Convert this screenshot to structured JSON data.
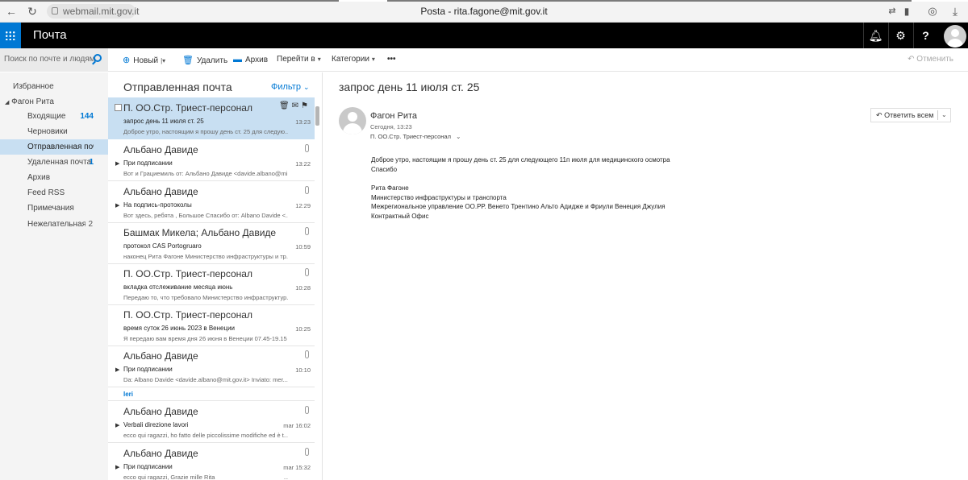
{
  "browser": {
    "url": "webmail.mit.gov.it",
    "title": "Posta - rita.fagone@mit.gov.it"
  },
  "suite": {
    "app_name": "Почта",
    "help": "?"
  },
  "toolbar": {
    "search_placeholder": "Поиск по почте и людям",
    "new": "Новый",
    "delete": "Удалить",
    "archive": "Архив",
    "move": "Перейти в",
    "categories": "Категории",
    "more": "•••",
    "undo": "Отменить"
  },
  "nav": {
    "favorites": "Избранное",
    "account": "Фагон Рита",
    "items": [
      {
        "label": "Входящие",
        "count": "144"
      },
      {
        "label": "Черновики",
        "count": ""
      },
      {
        "label": "Отправленная почта",
        "count": ""
      },
      {
        "label": "Удаленная почта",
        "count": "1"
      },
      {
        "label": "Архив",
        "count": ""
      },
      {
        "label": "Feed RSS",
        "count": ""
      },
      {
        "label": "Примечания",
        "count": ""
      },
      {
        "label": "Нежелательная почта",
        "count": "2"
      }
    ]
  },
  "list": {
    "title": "Отправленная почта",
    "filter": "Фильтр",
    "group_yesterday": "Ieri",
    "messages": [
      {
        "from": "П. ОО.Стр. Триест-персонал",
        "subject": "запрос день 11 июля ст. 25",
        "preview": "Доброе утро, настоящим я прошу день ст. 25 для следую...",
        "time": "13:23"
      },
      {
        "from": "Альбано Давиде",
        "subject": "При подписании",
        "preview": "Вот и Грациемиль от: Альбано Давиде <davide.albano@mi...",
        "time": "13:22"
      },
      {
        "from": "Альбано Давиде",
        "subject": "На подпись-протоколы",
        "preview": "Вот здесь, ребята , Большое Спасибо от: Albano Davide <...",
        "time": "12:29"
      },
      {
        "from": "Башмак Микела; Альбано Давиде",
        "subject": "протокол CAS Portogruaro",
        "preview": "наконец Рита Фагоне Министерство инфраструктуры и тр...",
        "time": "10:59"
      },
      {
        "from": "П. ОО.Стр. Триест-персонал",
        "subject": "вкладка отслеживание месяца июнь",
        "preview": "Передаю то, что требовало Министерство инфраструктур...",
        "time": "10:28"
      },
      {
        "from": "П. ОО.Стр. Триест-персонал",
        "subject": "время суток 26 июнь 2023 в Венеции",
        "preview": "Я передаю вам время дня 26 июня в Венеции 07.45-19.15 ...",
        "time": "10:25"
      },
      {
        "from": "Альбано Давиде",
        "subject": "При подписании",
        "preview": "Da: Albano Davide <davide.albano@mit.gov.it> Inviato: mer...",
        "time": "10:10"
      },
      {
        "from": "Альбано Давиде",
        "subject": "Verbali direzione lavori",
        "preview": "ecco qui ragazzi, ho fatto delle piccolissime modifiche ed è t...",
        "time": "mar 16:02"
      },
      {
        "from": "Альбано Давиде",
        "subject": "При подписании",
        "preview": "ecco qui ragazzi, Grazie mille Rita ____________________...",
        "time": "mar 15:32"
      }
    ]
  },
  "reading": {
    "subject": "запрос день 11 июля ст. 25",
    "from": "Фагон Рита",
    "date": "Сегодня, 13:23",
    "to": "П. ОО.Стр. Триест-персонал",
    "reply_all": "Ответить всем",
    "body": [
      "Доброе утро, настоящим я прошу день ст. 25 для следующего 11п июля для медицинского осмотра",
      "Спасибо",
      "",
      "Рита Фагоне",
      "Министерство инфраструктуры и транспорта",
      "Межрегиональное управление ОО.РР. Венето Трентино Альто Адидже и Фриули Венеция Джулия",
      "Контрактный Офис"
    ]
  }
}
